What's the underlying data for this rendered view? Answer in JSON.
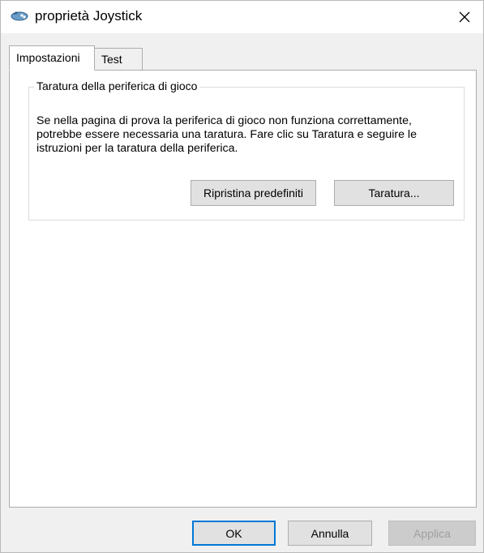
{
  "window": {
    "title": "proprietà Joystick",
    "icon": "joystick-icon",
    "close_icon": "close-icon"
  },
  "tabs": [
    {
      "label": "Impostazioni",
      "active": true
    },
    {
      "label": "Test",
      "active": false
    }
  ],
  "calibration_group": {
    "title": "Taratura della periferica di gioco",
    "description": "Se nella pagina di prova la periferica di gioco non funziona correttamente, potrebbe essere necessaria una taratura. Fare clic su Taratura e seguire le istruzioni per la taratura della periferica.",
    "reset_button_label": "Ripristina predefiniti",
    "calibrate_button_label": "Taratura..."
  },
  "footer": {
    "ok_label": "OK",
    "cancel_label": "Annulla",
    "apply_label": "Applica",
    "apply_enabled": false
  },
  "colors": {
    "focus_border": "#0078d7",
    "disabled_text": "#a0a0a0",
    "window_bg": "#f0f0f0"
  }
}
